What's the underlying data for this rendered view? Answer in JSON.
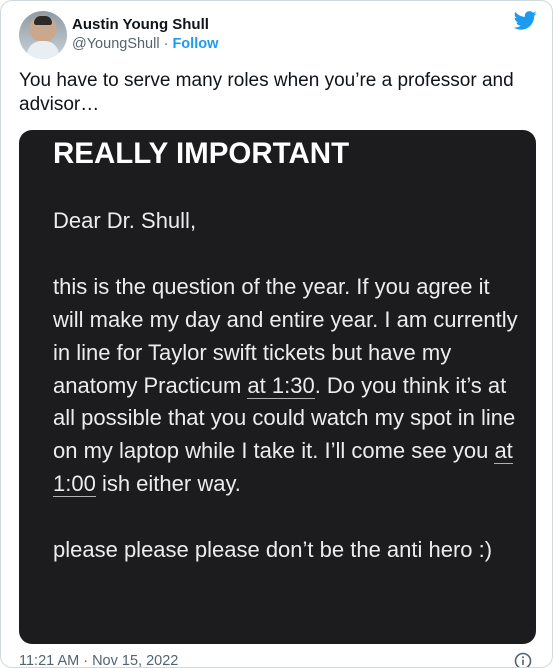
{
  "tweet": {
    "author": {
      "display_name": "Austin Young Shull",
      "handle": "@YoungShull",
      "separator": " · ",
      "follow_label": "Follow"
    },
    "text": "You have to serve many roles when you’re a professor and advisor…",
    "timestamp": "11:21 AM · Nov 15, 2022",
    "icons": {
      "brand": "twitter-bird-icon",
      "info": "info-icon"
    },
    "colors": {
      "brand": "#1d9bf0",
      "media_bg": "#1c1c1e",
      "muted": "#536471"
    }
  },
  "message": {
    "subject": "REALLY IMPORTANT",
    "greeting": "Dear Dr. Shull,",
    "p1_a": "this is the question of the year. If you agree it will make my day and entire year. I am currently in line for Taylor swift tickets but have my anatomy Practicum ",
    "p1_time1": "at 1:30",
    "p1_b": ". Do you think it’s at all possible that you could watch my spot in line on my laptop while I take it. I’ll come see you ",
    "p1_time2": "at 1:00",
    "p1_c": " ish either way.",
    "closing": "please please please don’t be the anti hero :)"
  }
}
